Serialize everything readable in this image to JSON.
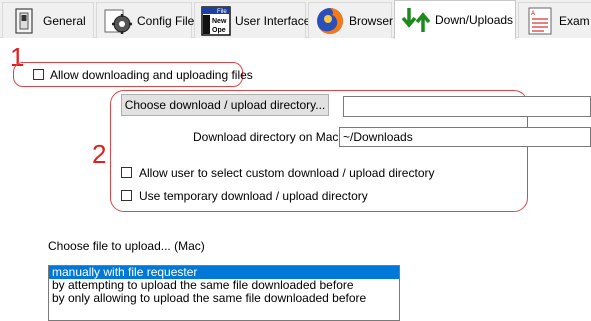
{
  "tabs": [
    {
      "label": "General",
      "icon": "switch-icon",
      "active": false
    },
    {
      "label": "Config File",
      "icon": "config-gear-icon",
      "active": false
    },
    {
      "label": "User Interface",
      "icon": "new-file-window-icon",
      "active": false
    },
    {
      "label": "Browser",
      "icon": "firefox-icon",
      "active": false
    },
    {
      "label": "Down/Uploads",
      "icon": "down-up-arrows-icon",
      "active": true
    },
    {
      "label": "Exam",
      "icon": "exam-sheet-icon",
      "active": false
    }
  ],
  "annotations": {
    "one": "1",
    "two": "2",
    "color": "#d84a4a"
  },
  "allow_updown": {
    "label": "Allow downloading and uploading files",
    "checked": false
  },
  "directory": {
    "choose_button": "Choose download / upload directory...",
    "choose_value": "",
    "mac_label": "Download directory on Mac",
    "mac_value": "~/Downloads"
  },
  "custom_dir": {
    "label": "Allow user to select custom download / upload directory",
    "checked": false
  },
  "temp_dir": {
    "label": "Use temporary download / upload directory",
    "checked": false
  },
  "upload_choice": {
    "label": "Choose file to upload... (Mac)",
    "options": [
      "manually with file requester",
      "by attempting to upload the same file downloaded before",
      "by only allowing to upload the same file downloaded before"
    ],
    "selected_index": 0,
    "selection_color": "#0078d7"
  }
}
